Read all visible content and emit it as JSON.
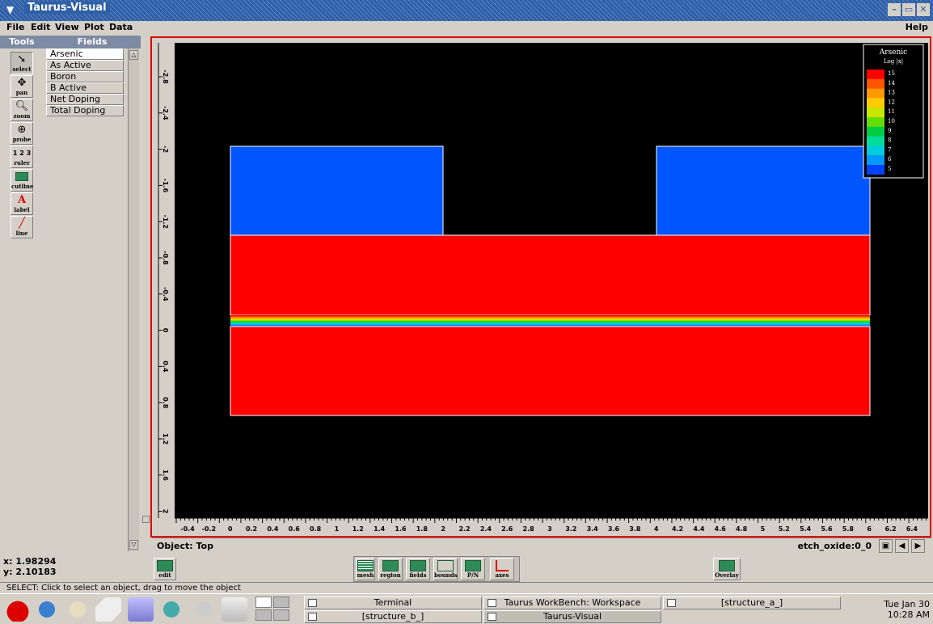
{
  "window": {
    "title": "Taurus-Visual"
  },
  "menu": {
    "file": "File",
    "edit": "Edit",
    "view": "View",
    "plot": "Plot",
    "data": "Data",
    "help": "Help"
  },
  "tools": {
    "header": "Tools",
    "items": [
      {
        "label": "select",
        "icon": "arrow-icon"
      },
      {
        "label": "pan",
        "icon": "move-icon"
      },
      {
        "label": "zoom",
        "icon": "magnifier-icon"
      },
      {
        "label": "probe",
        "icon": "crosshair-icon"
      },
      {
        "label": "ruler",
        "icon": "ruler-icon"
      },
      {
        "label": "cutline",
        "icon": "cutline-icon"
      },
      {
        "label": "label",
        "icon": "letter-a-icon"
      },
      {
        "label": "line",
        "icon": "line-icon"
      }
    ]
  },
  "fields": {
    "header": "Fields",
    "items": [
      "Arsenic",
      "As Active",
      "Boron",
      "B Active",
      "Net Doping",
      "Total Doping"
    ],
    "selected": "Arsenic"
  },
  "plot": {
    "x_ticks": [
      "-0.4",
      "-0.2",
      "0",
      "0.2",
      "0.4",
      "0.6",
      "0.8",
      "1",
      "1.2",
      "1.4",
      "1.6",
      "1.8",
      "2",
      "2.2",
      "2.4",
      "2.6",
      "2.8",
      "3",
      "3.2",
      "3.4",
      "3.6",
      "3.8",
      "4",
      "4.2",
      "4.4",
      "4.6",
      "4.8",
      "5",
      "5.2",
      "5.4",
      "5.6",
      "5.8",
      "6",
      "6.2",
      "6.4"
    ],
    "y_ticks": [
      "-2.8",
      "-2.4",
      "-2",
      "-1.6",
      "-1.2",
      "-0.8",
      "-0.4",
      "0",
      "0.4",
      "0.8",
      "1.2",
      "1.6",
      "2"
    ],
    "legend": {
      "title": "Arsenic",
      "subtitle": "Log |x|",
      "levels": [
        "15",
        "14",
        "13",
        "12",
        "11",
        "10",
        "9",
        "8",
        "7",
        "6",
        "5"
      ],
      "colors": [
        "#ff0000",
        "#ff5500",
        "#ff9900",
        "#ffcc00",
        "#c8e600",
        "#66dd00",
        "#00cc44",
        "#00dd99",
        "#00ccdd",
        "#0099ff",
        "#0044ff"
      ]
    },
    "regions": {
      "oxide_color": "#0055ff",
      "silicon_color": "#ff0000",
      "background": "#000000"
    }
  },
  "objectbar": {
    "label": "Object: Top",
    "name": "etch_oxide:0_0"
  },
  "coords": {
    "x": "x:  1.98294",
    "y": "y:  2.10183"
  },
  "bottom_tools": {
    "edit": "edit",
    "mesh": "mesh",
    "region": "region",
    "fields": "fields",
    "bounds": "bounds",
    "pn": "P/N",
    "axes": "axes",
    "overlay": "Overlay"
  },
  "status": "SELECT: Click to select an object, drag to move the object",
  "taskbar": {
    "tasks": [
      "Terminal",
      "Taurus WorkBench: Workspace",
      "[structure_a_]",
      "[structure_b_]",
      "Taurus-Visual"
    ],
    "clock_day": "Tue Jan 30",
    "clock_time": "10:28 AM"
  }
}
